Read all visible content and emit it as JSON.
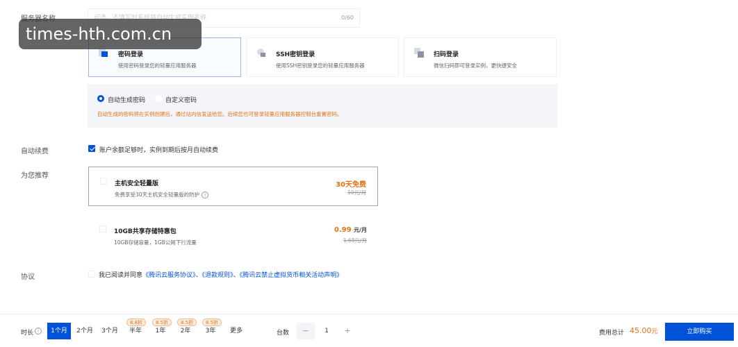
{
  "instance_name": {
    "label": "服务器名称",
    "placeholder": "可选，不填写时系统将自动生成实例名称",
    "counter": "0/60"
  },
  "watermark": "times-hth.com.cn",
  "login_methods": [
    {
      "title": "密码登录",
      "desc": "使用密码登录您的轻量应用服务器",
      "icon": "password-login-icon",
      "selected": true
    },
    {
      "title": "SSH密钥登录",
      "desc": "使用SSH密钥登录您的轻量应用服务器",
      "icon": "ssh-key-icon",
      "selected": false
    },
    {
      "title": "扫码登录",
      "desc": "微信扫码即可登录实例，更快捷安全",
      "icon": "qr-code-icon",
      "selected": false
    }
  ],
  "password": {
    "options": [
      {
        "label": "自动生成密码",
        "selected": true
      },
      {
        "label": "自定义密码",
        "selected": false
      }
    ],
    "tip": "自动生成的密码将在实例创建后，通过站内信发送给您。后续您也可登录轻量应用服务器控制台重置密码。"
  },
  "auto_renew": {
    "label": "自动续费",
    "text": "账户余额足够时，实例到期后按月自动续费",
    "checked": true
  },
  "recommend": {
    "label": "为您推荐",
    "items": [
      {
        "title": "主机安全轻量版",
        "desc": "免费享受30天主机安全轻量版的防护",
        "price": "30天免费",
        "unit": "",
        "old_price": "10元/月",
        "checked": false
      },
      {
        "title": "10GB共享存储特惠包",
        "desc": "10GB存储容量，1GB公网下行流量",
        "price": "0.99",
        "unit": "元/月",
        "old_price": "1.68元/月",
        "checked": false
      }
    ]
  },
  "agreement": {
    "label": "协议",
    "prefix": "我已阅读并同意",
    "links": [
      "《腾讯云服务协议》",
      "《退款规则》",
      "《腾讯云禁止虚拟货币相关活动声明》"
    ],
    "sep": "、",
    "checked": false
  },
  "bottom": {
    "duration_label": "时长",
    "durations": [
      {
        "label": "1个月",
        "active": true,
        "discount": ""
      },
      {
        "label": "2个月",
        "active": false,
        "discount": ""
      },
      {
        "label": "3个月",
        "active": false,
        "discount": ""
      },
      {
        "label": "半年",
        "active": false,
        "discount": "8.8折"
      },
      {
        "label": "1年",
        "active": false,
        "discount": "8.5折"
      },
      {
        "label": "2年",
        "active": false,
        "discount": "8.5折"
      },
      {
        "label": "3年",
        "active": false,
        "discount": "8.5折"
      },
      {
        "label": "更多",
        "active": false,
        "discount": ""
      }
    ],
    "quantity_label": "台数",
    "minus": "−",
    "quantity": "1",
    "plus": "+",
    "total_label": "费用总计",
    "total": "45.00",
    "total_unit": "元",
    "buy_label": "立即购买"
  },
  "colors": {
    "primary": "#0052d9",
    "warning": "#e37318"
  }
}
